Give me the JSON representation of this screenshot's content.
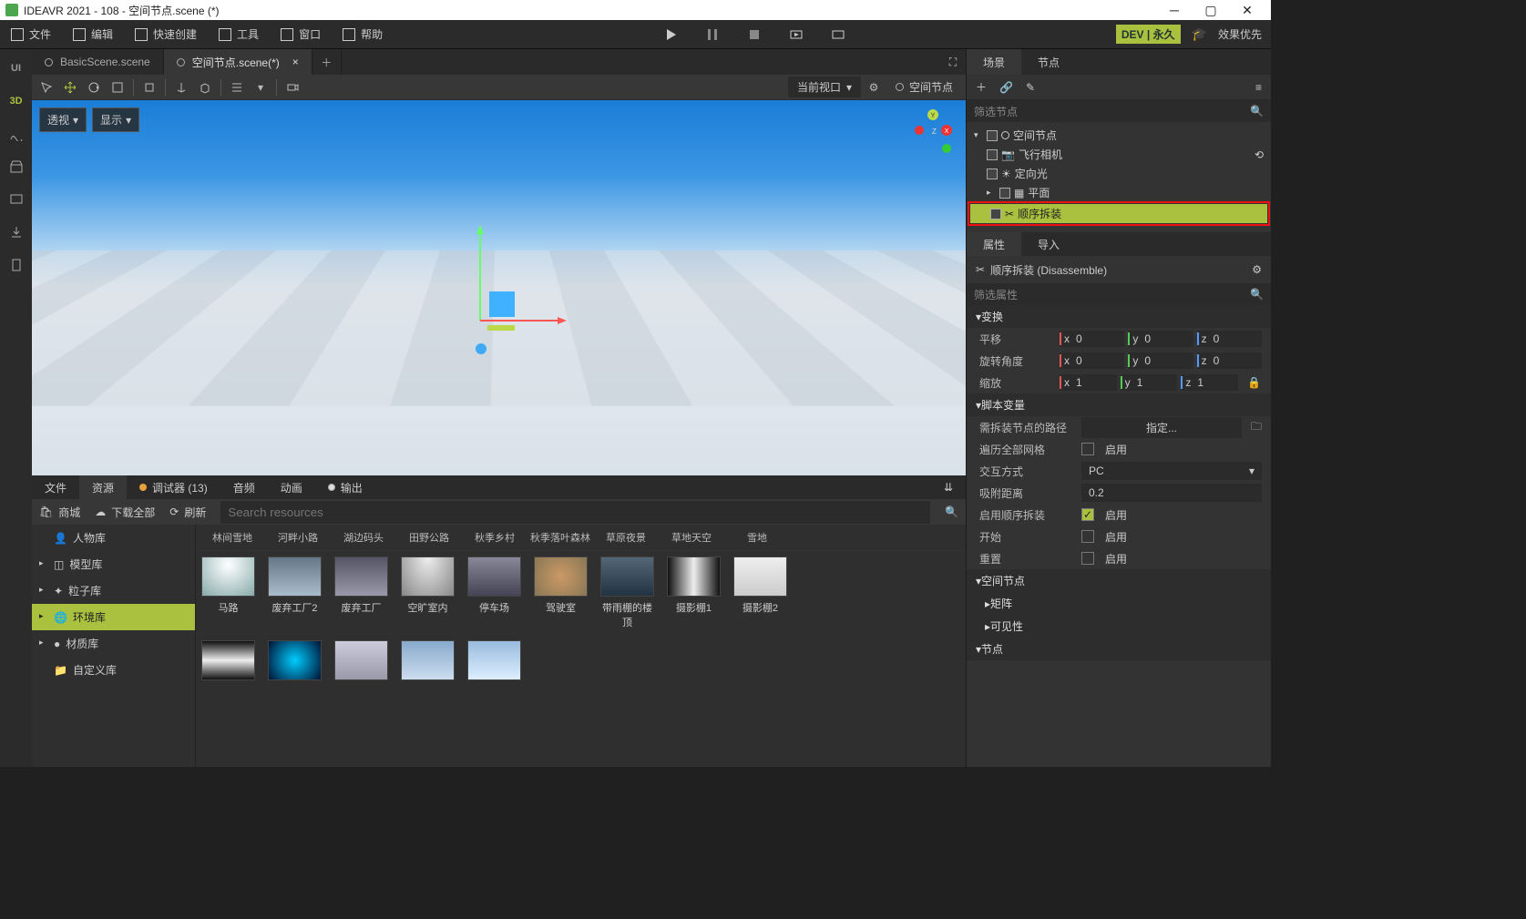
{
  "titlebar": {
    "title": "IDEAVR 2021 - 108 - 空间节点.scene (*)"
  },
  "menubar": {
    "file": "文件",
    "edit": "编辑",
    "quickcreate": "快速创建",
    "tools": "工具",
    "window": "窗口",
    "help": "帮助",
    "dev": "DEV | 永久",
    "perf": "效果优先"
  },
  "leftbar": {
    "ui": "UI",
    "threed": "3D"
  },
  "tabs": {
    "scene1": "BasicScene.scene",
    "scene2": "空间节点.scene(*)"
  },
  "vptool": {
    "persp": "透视",
    "display": "显示",
    "curview": "当前视口",
    "crumb": "空间节点"
  },
  "bottom": {
    "tabs": {
      "file": "文件",
      "resource": "资源",
      "debugger": "调试器 (13)",
      "audio": "音频",
      "anim": "动画",
      "output": "输出"
    },
    "toolbar": {
      "mall": "商城",
      "dlall": "下载全部",
      "refresh": "刷新",
      "search_ph": "Search resources"
    },
    "sidecats": {
      "char": "人物库",
      "model": "模型库",
      "particle": "粒子库",
      "env": "环境库",
      "mat": "材质库",
      "custom": "自定义库"
    },
    "catrow": [
      "林间雪地",
      "河畔小路",
      "湖边码头",
      "田野公路",
      "秋季乡村",
      "秋季落叶森林",
      "草原夜景",
      "草地天空",
      "雪地"
    ],
    "thumbs": [
      "马路",
      "废弃工厂2",
      "废弃工厂",
      "空旷室内",
      "停车场",
      "驾驶室",
      "带雨棚的楼顶",
      "摄影棚1",
      "摄影棚2"
    ]
  },
  "right": {
    "toptabs": {
      "scene": "场景",
      "node": "节点"
    },
    "filter": "筛选节点",
    "tree": {
      "root": "空间节点",
      "cam": "飞行相机",
      "light": "定向光",
      "plane": "平面",
      "disasm": "顺序拆装"
    },
    "proptabs": {
      "props": "属性",
      "import": "导入"
    },
    "prophead": "顺序拆装 (Disassemble)",
    "propfilter": "筛选属性",
    "groups": {
      "transform": "变换",
      "scriptvar": "脚本变量",
      "spatial": "空间节点",
      "matrix": "矩阵",
      "visibility": "可见性",
      "node": "节点"
    },
    "rows": {
      "translate": "平移",
      "rotate": "旋转角度",
      "scale": "缩放",
      "path": "需拆装节点的路径",
      "pathbtn": "指定...",
      "traverse": "遍历全部网格",
      "enable": "启用",
      "interact": "交互方式",
      "pc": "PC",
      "snapdist": "吸附距离",
      "snapdist_v": "0.2",
      "enorder": "启用顺序拆装",
      "start": "开始",
      "reset": "重置"
    },
    "xyz": {
      "tx": "0",
      "ty": "0",
      "tz": "0",
      "rx": "0",
      "ry": "0",
      "rz": "0",
      "sx": "1",
      "sy": "1",
      "sz": "1"
    }
  }
}
